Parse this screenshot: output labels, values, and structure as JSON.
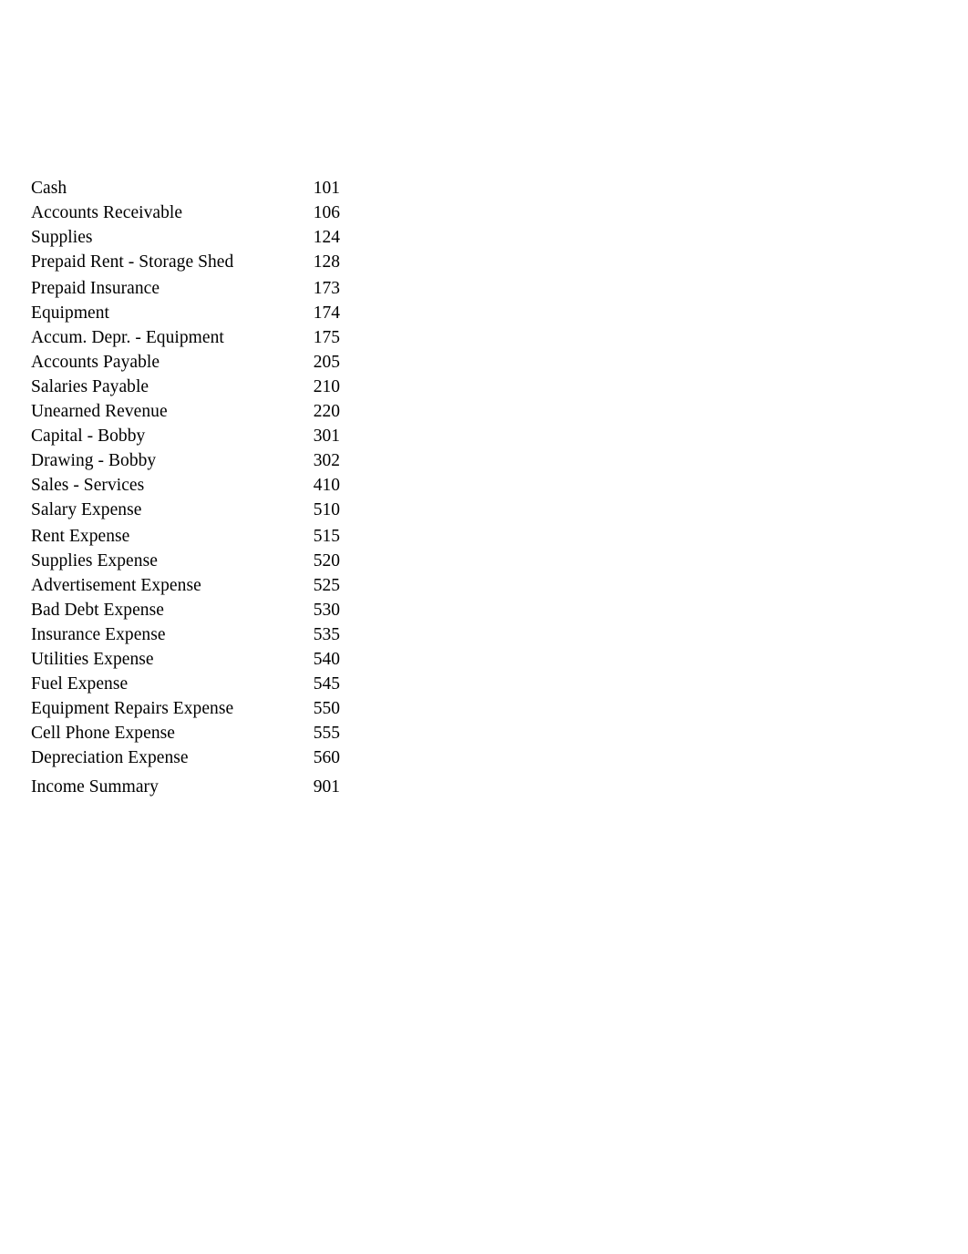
{
  "document": {
    "type": "chart-of-accounts",
    "background_color": "#ffffff",
    "text_color": "#000000"
  },
  "accounts": [
    {
      "name": "Cash",
      "number": "101",
      "spacing": "normal"
    },
    {
      "name": "Accounts Receivable",
      "number": "106",
      "spacing": "normal"
    },
    {
      "name": "Supplies",
      "number": "124",
      "spacing": "normal"
    },
    {
      "name": "Prepaid Rent - Storage Shed",
      "number": "128",
      "spacing": "normal"
    },
    {
      "name": "Prepaid Insurance",
      "number": "173",
      "spacing": "gap"
    },
    {
      "name": "Equipment",
      "number": "174",
      "spacing": "normal"
    },
    {
      "name": "Accum. Depr. - Equipment",
      "number": "175",
      "spacing": "normal"
    },
    {
      "name": "Accounts Payable",
      "number": "205",
      "spacing": "normal"
    },
    {
      "name": "Salaries Payable",
      "number": "210",
      "spacing": "normal"
    },
    {
      "name": "Unearned Revenue",
      "number": "220",
      "spacing": "normal"
    },
    {
      "name": "Capital - Bobby",
      "number": "301",
      "spacing": "normal"
    },
    {
      "name": "Drawing - Bobby",
      "number": "302",
      "spacing": "normal"
    },
    {
      "name": "Sales - Services",
      "number": "410",
      "spacing": "normal"
    },
    {
      "name": "Salary Expense",
      "number": "510",
      "spacing": "normal"
    },
    {
      "name": "Rent Expense",
      "number": "515",
      "spacing": "gap"
    },
    {
      "name": "Supplies Expense",
      "number": "520",
      "spacing": "normal"
    },
    {
      "name": "Advertisement Expense",
      "number": "525",
      "spacing": "normal"
    },
    {
      "name": "Bad Debt Expense",
      "number": "530",
      "spacing": "normal"
    },
    {
      "name": "Insurance Expense",
      "number": "535",
      "spacing": "normal"
    },
    {
      "name": "Utilities Expense",
      "number": "540",
      "spacing": "normal"
    },
    {
      "name": "Fuel Expense",
      "number": "545",
      "spacing": "normal"
    },
    {
      "name": "Equipment Repairs Expense",
      "number": "550",
      "spacing": "normal"
    },
    {
      "name": "Cell Phone Expense",
      "number": "555",
      "spacing": "normal"
    },
    {
      "name": "Depreciation Expense",
      "number": "560",
      "spacing": "normal"
    },
    {
      "name": "Income Summary",
      "number": "901",
      "spacing": "gap-large"
    }
  ]
}
